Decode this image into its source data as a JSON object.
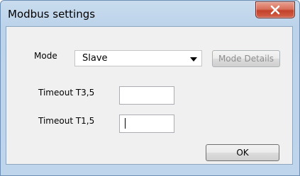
{
  "window": {
    "title": "Modbus settings"
  },
  "icons": {
    "close": "close-icon",
    "dropdown": "chevron-down-icon"
  },
  "form": {
    "mode_label": "Mode",
    "mode_value": "Slave",
    "mode_details_label": "Mode Details",
    "t35_label": "Timeout T3,5",
    "t35_value": "",
    "t15_label": "Timeout T1,5",
    "t15_value": "",
    "ok_label": "OK"
  },
  "colors": {
    "close_button": "#c2412a",
    "dialog_background": "#f0f0f0",
    "frame": "#bcd3ea"
  }
}
